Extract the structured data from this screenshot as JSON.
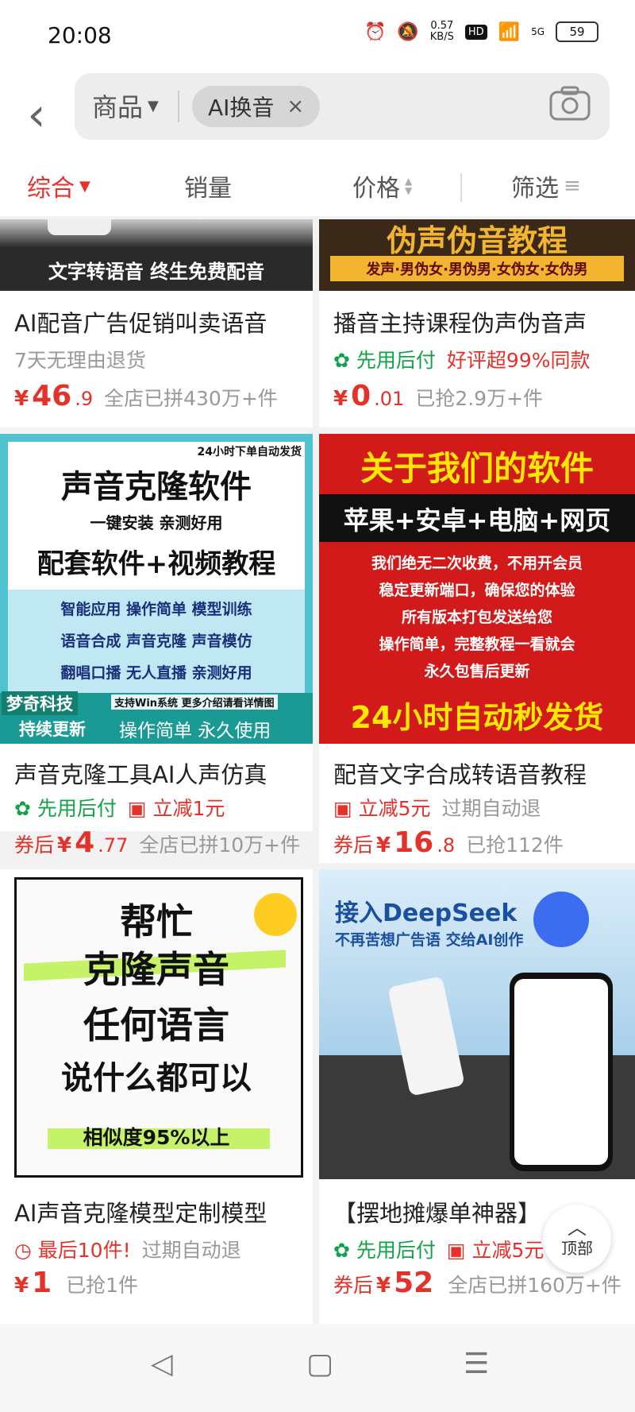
{
  "status": {
    "time": "20:08",
    "netspeed": "0.57",
    "netunit": "KB/S",
    "hd": "HD",
    "signal": "5G",
    "battery": "59"
  },
  "search": {
    "scope_label": "商品",
    "query": "AI换音"
  },
  "tabs": [
    {
      "label": "综合"
    },
    {
      "label": "销量"
    },
    {
      "label": "价格"
    },
    {
      "label": "筛选"
    }
  ],
  "banners": {
    "p1": "文字转语音 终生免费配音",
    "p2_top": "伪声伪音教程",
    "p2_bottom": "发声·男伪女·男伪男·女伪女·女伪男",
    "p3": {
      "corner": "24小时下单自动发货",
      "h1": "声音克隆软件",
      "sub": "一键安装 亲测好用",
      "h2": "配套软件+视频教程",
      "lines": [
        "智能应用 操作简单 模型训练",
        "语音合成 声音克隆 声音模仿",
        "翻唱口播 无人直播 亲测好用"
      ],
      "brand": "梦奇科技",
      "brand2": "持续更新",
      "win": "支持Win系统 更多介绍请看详情图",
      "foot": "操作简单 永久使用"
    },
    "p4": {
      "h1": "关于我们的软件",
      "band": "苹果+安卓+电脑+网页",
      "lines": [
        "我们绝无二次收费，不用开会员",
        "稳定更新端口，确保您的体验",
        "所有版本打包发送给您",
        "操作简单，完整教程一看就会",
        "永久包售后更新"
      ],
      "foot": "24小时自动秒发货"
    },
    "p5": {
      "lines": [
        "帮忙",
        "克隆声音",
        "任何语言",
        "说什么都可以"
      ],
      "foot": "相似度95%以上"
    },
    "p6": {
      "h1": "接入DeepSeek",
      "sub": "不再苦想广告语 交给AI创作"
    }
  },
  "products": [
    {
      "title": "AI配音广告促销叫卖语音",
      "tag1": "7天无理由退货",
      "tag2": "",
      "prefix": "",
      "yen": "¥",
      "int": "46",
      "dec": ".9",
      "sold": "全店已拼430万+件"
    },
    {
      "title": "播音主持课程伪声伪音声",
      "tag1": "先用后付",
      "tag2": "好评超99%同款",
      "prefix": "",
      "yen": "¥",
      "int": "0",
      "dec": ".01",
      "sold": "已抢2.9万+件"
    },
    {
      "title": "声音克隆工具AI人声仿真",
      "tag1": "先用后付",
      "tag2": "立减1元",
      "prefix": "券后",
      "yen": "¥",
      "int": "4",
      "dec": ".77",
      "sold": "全店已拼10万+件"
    },
    {
      "title": "配音文字合成转语音教程",
      "tag1": "立减5元",
      "tag2": "过期自动退",
      "prefix": "券后",
      "yen": "¥",
      "int": "16",
      "dec": ".8",
      "sold": "已抢112件"
    },
    {
      "title": "AI声音克隆模型定制模型",
      "tag1": "最后10件!",
      "tag2": "过期自动退",
      "prefix": "",
      "yen": "¥",
      "int": "1",
      "dec": "",
      "sold": "已抢1件"
    },
    {
      "title": "【摆地摊爆单神器】",
      "tag1": "先用后付",
      "tag2": "立减5元",
      "prefix": "券后",
      "yen": "¥",
      "int": "52",
      "dec": "",
      "sold": "全店已拼160万+件"
    }
  ],
  "float_top": "顶部",
  "colors": {
    "accent": "#e4322a",
    "green": "#13a24a"
  }
}
